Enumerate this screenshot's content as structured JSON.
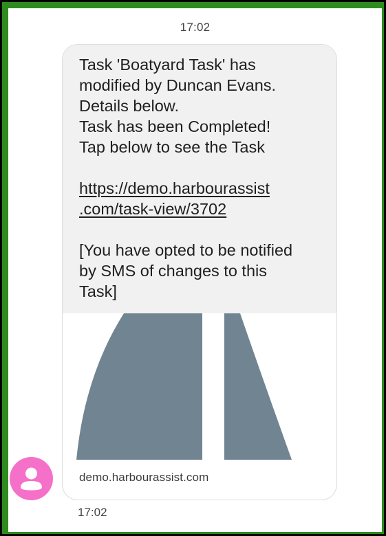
{
  "conversation": {
    "top_timestamp": "17:02",
    "bottom_timestamp": "17:02"
  },
  "message": {
    "lines": [
      "Task 'Boatyard Task' has",
      "modified by Duncan Evans.",
      "Details below.",
      "Task has been Completed!",
      "Tap below to see the Task"
    ],
    "link_lines": [
      "https://demo.harbourassist",
      ".com/task-view/3702"
    ],
    "footer_lines": [
      "[You have opted to be notified",
      "by SMS of changes to this",
      "Task]"
    ]
  },
  "link_preview": {
    "image_icon": "road-icon",
    "domain": "demo.harbourassist.com"
  },
  "sender": {
    "avatar_icon": "person-icon"
  },
  "colors": {
    "frame": "#2e8b1e",
    "bubble_background": "#f1f1f1",
    "avatar": "#f570c8",
    "road": "#718491"
  }
}
